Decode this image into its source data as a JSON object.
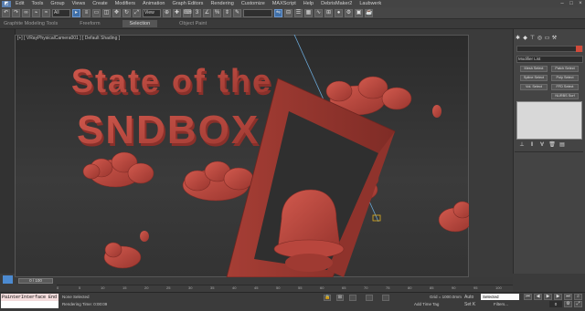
{
  "menubar": {
    "items": [
      "Edit",
      "Tools",
      "Group",
      "Views",
      "Create",
      "Modifiers",
      "Animation",
      "Graph Editors",
      "Rendering",
      "Customize",
      "MAXScript",
      "Help",
      "DebrisMaker2",
      "Laubwerk"
    ]
  },
  "toolbar": {
    "filter_value": "All",
    "view_value": "View"
  },
  "ribbon": {
    "tabs": [
      "Graphite Modeling Tools",
      "Freeform",
      "Selection",
      "Object Paint"
    ],
    "active": "Selection"
  },
  "viewport": {
    "label": "[+] [ VRayPhysicalCamera001 ] [ Default Shading ]",
    "scene_text_line1": "State of the",
    "scene_text_line2": "SNDBOX"
  },
  "command_panel": {
    "modifier_list": "Modifier List",
    "buttons": [
      "Mesh Select",
      "Patch Select",
      "Spline Select",
      "Poly Select",
      "Vol. Select",
      "FFD Select",
      "",
      "NURBS Surf"
    ]
  },
  "timeline": {
    "thumb": "0 / 100",
    "ticks": [
      "0",
      "5",
      "10",
      "15",
      "20",
      "25",
      "30",
      "35",
      "40",
      "45",
      "50",
      "55",
      "60",
      "65",
      "70",
      "75",
      "80",
      "85",
      "90",
      "95",
      "100"
    ]
  },
  "statusbar": {
    "maxscript_line": "PainterInterface End",
    "selection": "None Selected",
    "render_time": "Rendering Time: 0:00:09",
    "grid": "Grid = 1000.0mm",
    "add_time_tag": "Add Time Tag",
    "auto_key": "Auto",
    "set_key": "Set K",
    "selected_value": "Selected",
    "filters": "Filters...",
    "frame": "0"
  },
  "colors": {
    "clay": "#b8463d",
    "accent": "#3f6fa8"
  }
}
